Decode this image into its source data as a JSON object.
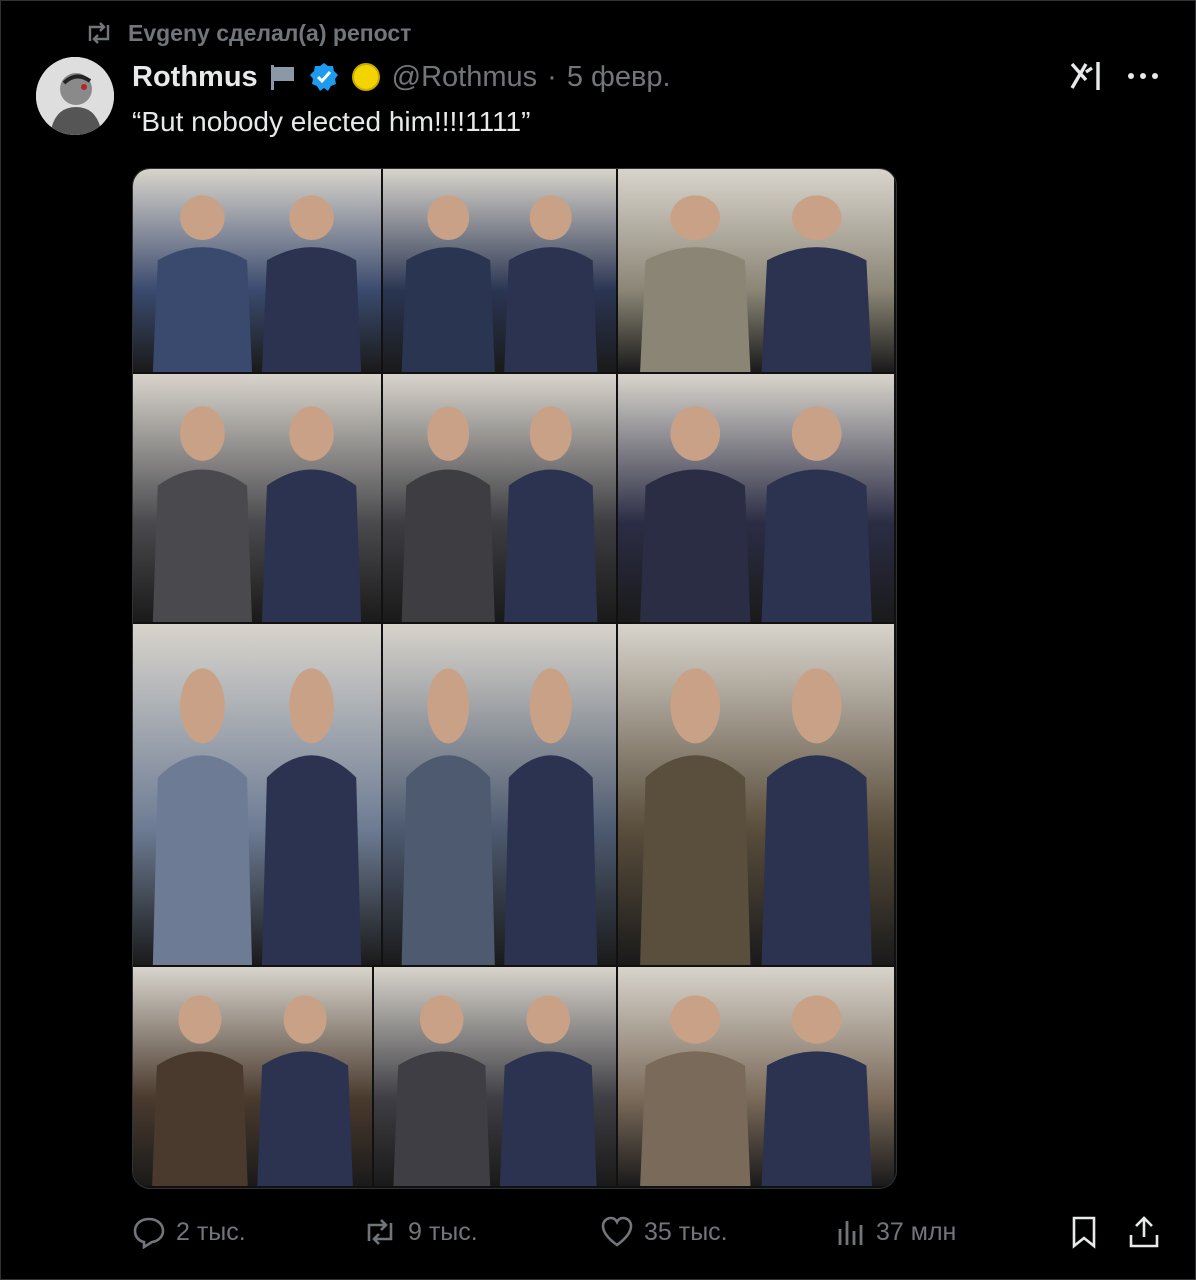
{
  "repost": {
    "text": "Evgeny сделал(а) репост",
    "icon": "repost-icon"
  },
  "post": {
    "author_name": "Rothmus",
    "handle": "@Rothmus",
    "separator": "·",
    "date": "5 февр.",
    "text": "“But nobody elected him!!!!1111”"
  },
  "colors": {
    "verified": "#1d9bf0",
    "muted": "#71767b",
    "text": "#e7e9ea",
    "background": "#000000"
  },
  "media": {
    "icon": "photo-collage",
    "rows": [
      [
        "#3a4a6e",
        "#2a3552",
        "#8a8575"
      ],
      [
        "#4a4a4e",
        "#3d3d42",
        "#2b2d45"
      ],
      [
        "#6d7c94",
        "#4d5a70",
        "#5a4e3c"
      ],
      [
        "#4a3a2e",
        "#3e3e44",
        "#7a6a5a"
      ]
    ]
  },
  "actions": {
    "replies": "2 тыс.",
    "reposts": "9 тыс.",
    "likes": "35 тыс.",
    "views": "37 млн"
  }
}
